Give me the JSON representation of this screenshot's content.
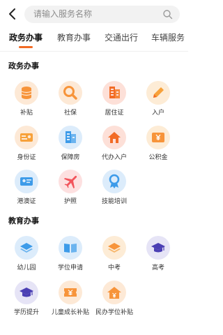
{
  "search": {
    "placeholder": "请输入服务名称"
  },
  "tabs": [
    "政务办事",
    "教育办事",
    "交通出行",
    "车辆服务"
  ],
  "sections": [
    {
      "title": "政务办事"
    },
    {
      "title": "教育办事"
    }
  ],
  "gov_items": [
    {
      "label": "补贴",
      "icon": "coins-icon"
    },
    {
      "label": "社保",
      "icon": "magnifier-icon"
    },
    {
      "label": "居住证",
      "icon": "building-icon"
    },
    {
      "label": "入户",
      "icon": "pencil-icon"
    },
    {
      "label": "身份证",
      "icon": "id-card-icon"
    },
    {
      "label": "保障房",
      "icon": "apartment-icon"
    },
    {
      "label": "代办入户",
      "icon": "house-icon"
    },
    {
      "label": "公积金",
      "icon": "wallet-icon"
    },
    {
      "label": "港澳证",
      "icon": "permit-card-icon"
    },
    {
      "label": "护照",
      "icon": "airplane-icon"
    },
    {
      "label": "技能培训",
      "icon": "award-icon"
    }
  ],
  "edu_items": [
    {
      "label": "幼儿园",
      "icon": "layers-icon"
    },
    {
      "label": "学位申请",
      "icon": "book-icon"
    },
    {
      "label": "中考",
      "icon": "stack-icon"
    },
    {
      "label": "高考",
      "icon": "graduation-cap-icon"
    },
    {
      "label": "学历提升",
      "icon": "mortarboard-icon"
    },
    {
      "label": "儿童成长补贴",
      "icon": "ticket-icon"
    },
    {
      "label": "民办学位补贴",
      "icon": "house-yuan-icon"
    }
  ],
  "colors": {
    "accent": "#f26b25",
    "orange": "#f7943a",
    "blue": "#3d9be9",
    "red": "#f2545b",
    "purple": "#4b3fb4"
  }
}
